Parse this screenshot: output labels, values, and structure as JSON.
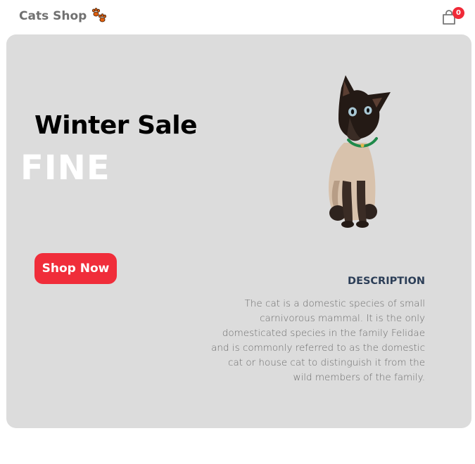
{
  "header": {
    "brand": "Cats Shop",
    "logo_icon": "paw-prints-icon",
    "cart_icon": "shopping-bag-icon",
    "cart_count": "0"
  },
  "hero": {
    "subtitle": "Winter Sale",
    "title": "FINE",
    "button_label": "Shop Now",
    "image": "siamese-cat-image",
    "description_heading": "DESCRIPTION",
    "description_text": "The cat is a domestic species of small carnivorous mammal. It is the only domesticated species in the family Felidae and is commonly referred to as the domestic cat or house cat to distinguish it from the wild members of the family."
  },
  "colors": {
    "accent": "#f02d3a",
    "hero_background": "#dcdcdc",
    "heading_dark": "#2c3e57"
  }
}
